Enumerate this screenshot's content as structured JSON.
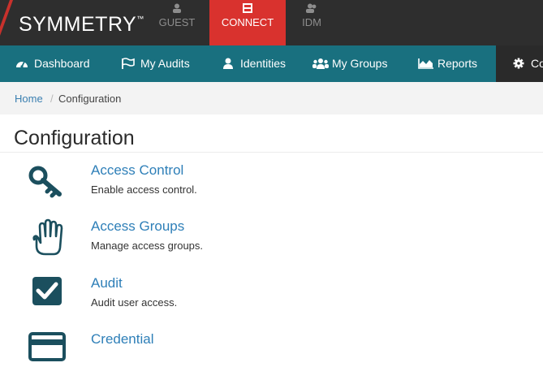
{
  "brand": {
    "logo_text": "SYMMETRY",
    "trademark": "™"
  },
  "app_tabs": [
    {
      "label": "GUEST",
      "icon": "person-icon"
    },
    {
      "label": "CONNECT",
      "icon": "door-icon",
      "active": true
    },
    {
      "label": "IDM",
      "icon": "users-icon"
    }
  ],
  "nav": [
    {
      "label": "Dashboard",
      "icon": "dashboard-icon"
    },
    {
      "label": "My Audits",
      "icon": "flag-icon"
    },
    {
      "label": "Identities",
      "icon": "user-icon"
    },
    {
      "label": "My Groups",
      "icon": "group-icon"
    },
    {
      "label": "Reports",
      "icon": "area-chart-icon"
    },
    {
      "label": "Co",
      "icon": "gear-icon"
    }
  ],
  "breadcrumb": {
    "home": "Home",
    "separator": "/",
    "current": "Configuration"
  },
  "page_title": "Configuration",
  "config_items": [
    {
      "title": "Access Control",
      "description": "Enable access control.",
      "icon": "key-icon"
    },
    {
      "title": "Access Groups",
      "description": "Manage access groups.",
      "icon": "hand-icon"
    },
    {
      "title": "Audit",
      "description": "Audit user access.",
      "icon": "checkbox-icon"
    },
    {
      "title": "Credential",
      "description": "",
      "icon": "card-icon"
    }
  ],
  "colors": {
    "topbar": "#2e2e2e",
    "accent_red": "#d9322e",
    "nav_teal": "#19707f",
    "icon_teal": "#1b4f5e",
    "link_blue": "#2e7fb8"
  }
}
